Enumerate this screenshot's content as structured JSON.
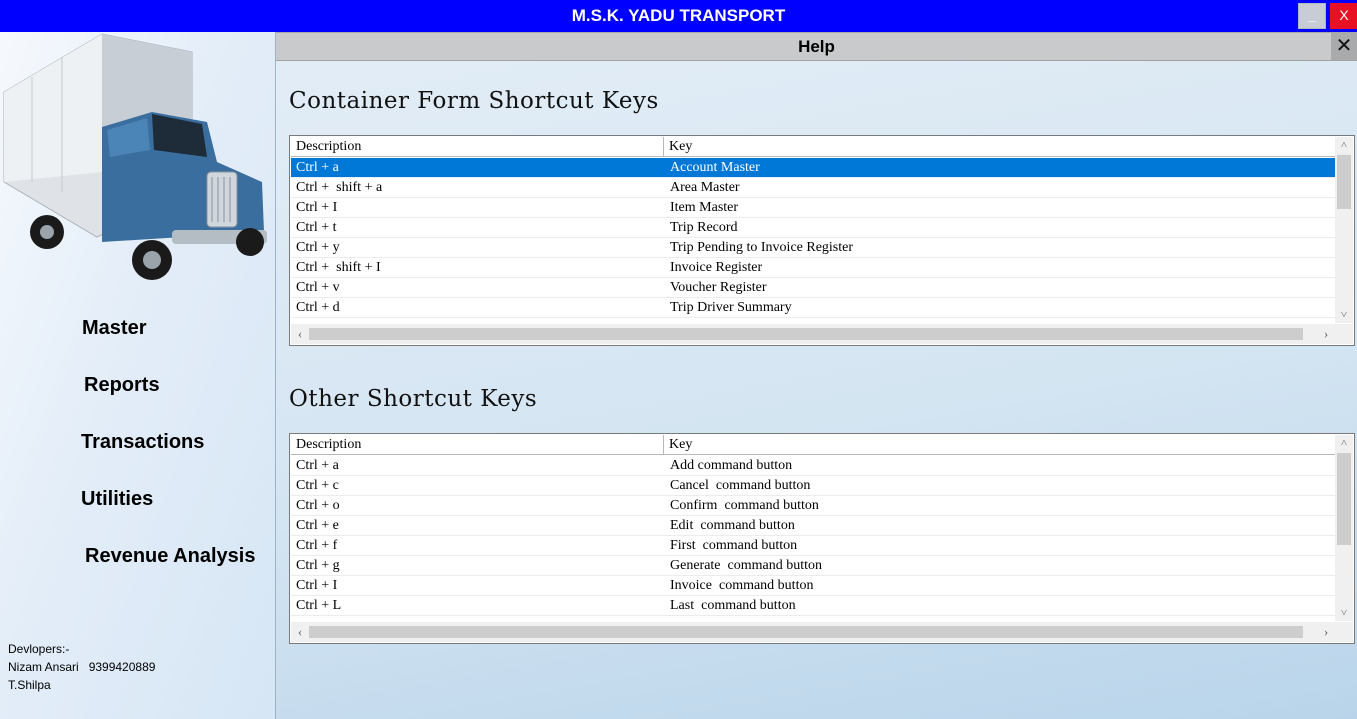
{
  "window": {
    "title": "M.S.K. YADU TRANSPORT",
    "minimize_label": "_",
    "close_label": "X"
  },
  "sidebar": {
    "menu": [
      {
        "label": "Master"
      },
      {
        "label": "Reports"
      },
      {
        "label": "Transactions"
      },
      {
        "label": "Utilities"
      },
      {
        "label": "Revenue Analysis"
      }
    ],
    "developers": {
      "heading": "Devlopers:-",
      "line1": "Nizam Ansari   9399420889",
      "line2": "T.Shilpa"
    }
  },
  "help": {
    "title": "Help",
    "close_label": "✕"
  },
  "container_section": {
    "title": "Container Form Shortcut Keys",
    "columns": [
      "Description",
      "Key"
    ],
    "rows": [
      {
        "description": "Ctrl + a",
        "key": "Account Master"
      },
      {
        "description": "Ctrl +  shift + a",
        "key": "Area Master"
      },
      {
        "description": "Ctrl + I",
        "key": "Item Master"
      },
      {
        "description": "Ctrl + t",
        "key": "Trip Record"
      },
      {
        "description": "Ctrl + y",
        "key": "Trip Pending to Invoice Register"
      },
      {
        "description": "Ctrl +  shift + I",
        "key": "Invoice Register"
      },
      {
        "description": "Ctrl + v",
        "key": "Voucher Register"
      },
      {
        "description": "Ctrl + d",
        "key": "Trip Driver Summary"
      }
    ],
    "selected_row": 0
  },
  "other_section": {
    "title": "Other Shortcut Keys",
    "columns": [
      "Description",
      "Key"
    ],
    "rows": [
      {
        "description": "Ctrl + a",
        "key": "Add command button"
      },
      {
        "description": "Ctrl + c",
        "key": "Cancel  command button"
      },
      {
        "description": "Ctrl + o",
        "key": "Confirm  command button"
      },
      {
        "description": "Ctrl + e",
        "key": "Edit  command button"
      },
      {
        "description": "Ctrl + f",
        "key": "First  command button"
      },
      {
        "description": "Ctrl + g",
        "key": "Generate  command button"
      },
      {
        "description": "Ctrl + I",
        "key": "Invoice  command button"
      },
      {
        "description": "Ctrl + L",
        "key": "Last  command button"
      }
    ]
  },
  "scroll_icons": {
    "up": "˄",
    "down": "˅",
    "left": "‹",
    "right": "›"
  },
  "colors": {
    "title_bar": "#0000ff",
    "selection": "#0078d7",
    "close_button": "#e81123"
  }
}
